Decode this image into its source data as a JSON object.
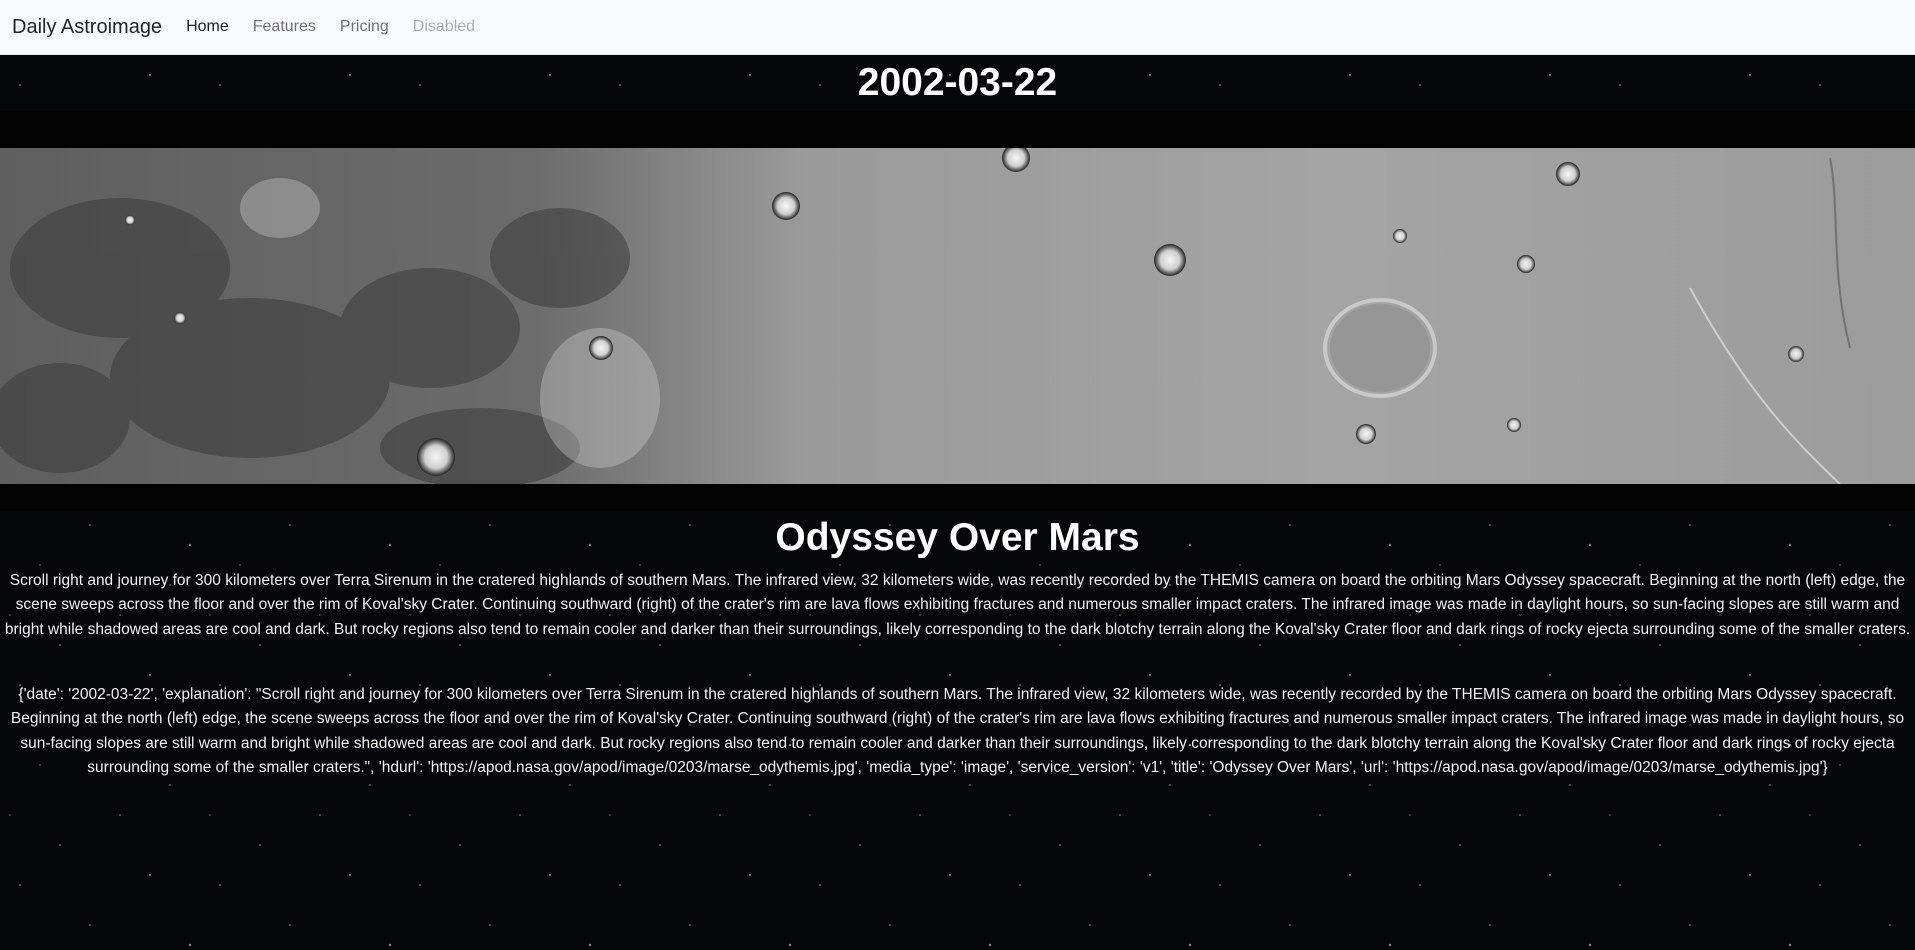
{
  "nav": {
    "brand": "Daily Astroimage",
    "links": [
      "Home",
      "Features",
      "Pricing",
      "Disabled"
    ]
  },
  "apod": {
    "date": "2002-03-22",
    "title": "Odyssey Over Mars",
    "explanation": "Scroll right and journey for 300 kilometers over Terra Sirenum in the cratered highlands of southern Mars. The infrared view, 32 kilometers wide, was recently recorded by the THEMIS camera on board the orbiting Mars Odyssey spacecraft. Beginning at the north (left) edge, the scene sweeps across the floor and over the rim of Koval'sky Crater. Continuing southward (right) of the crater's rim are lava flows exhibiting fractures and numerous smaller impact craters. The infrared image was made in daylight hours, so sun-facing slopes are still warm and bright while shadowed areas are cool and dark. But rocky regions also tend to remain cooler and darker than their surroundings, likely corresponding to the dark blotchy terrain along the Koval'sky Crater floor and dark rings of rocky ejecta surrounding some of the smaller craters.",
    "raw": "{'date': '2002-03-22', 'explanation': \"Scroll right and journey for 300 kilometers over Terra Sirenum in the cratered highlands of southern Mars. The infrared view, 32 kilometers wide, was recently recorded by the THEMIS camera on board the orbiting Mars Odyssey spacecraft. Beginning at the north (left) edge, the scene sweeps across the floor and over the rim of Koval'sky Crater. Continuing southward (right) of the crater's rim are lava flows exhibiting fractures and numerous smaller impact craters. The infrared image was made in daylight hours, so sun-facing slopes are still warm and bright while shadowed areas are cool and dark. But rocky regions also tend to remain cooler and darker than their surroundings, likely corresponding to the dark blotchy terrain along the Koval'sky Crater floor and dark rings of rocky ejecta surrounding some of the smaller craters.\", 'hdurl': 'https://apod.nasa.gov/apod/image/0203/marse_odythemis.jpg', 'media_type': 'image', 'service_version': 'v1', 'title': 'Odyssey Over Mars', 'url': 'https://apod.nasa.gov/apod/image/0203/marse_odythemis.jpg'}"
  }
}
